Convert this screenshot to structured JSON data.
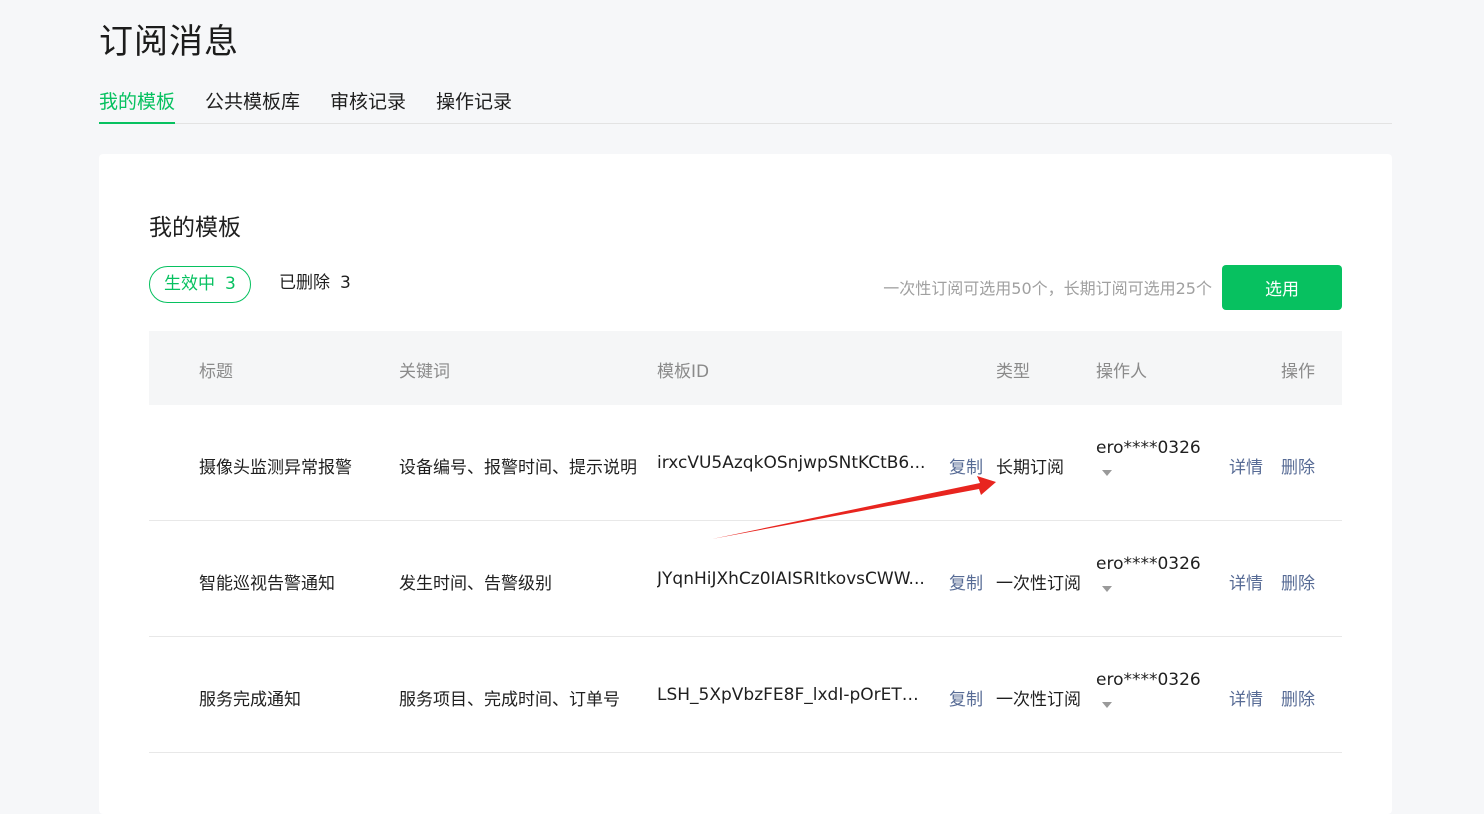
{
  "page": {
    "title": "订阅消息"
  },
  "tabs": [
    {
      "label": "我的模板",
      "active": true
    },
    {
      "label": "公共模板库",
      "active": false
    },
    {
      "label": "审核记录",
      "active": false
    },
    {
      "label": "操作记录",
      "active": false
    }
  ],
  "card": {
    "title": "我的模板",
    "filters": {
      "active": {
        "label": "生效中",
        "count": "3"
      },
      "deleted": {
        "label": "已删除",
        "count": "3"
      }
    },
    "quota_tip": "一次性订阅可选用50个，长期订阅可选用25个",
    "select_button": "选用"
  },
  "table": {
    "headers": {
      "title": "标题",
      "keywords": "关键词",
      "template_id": "模板ID",
      "type": "类型",
      "operator": "操作人",
      "actions": "操作"
    },
    "rows": [
      {
        "title": "摄像头监测异常报警",
        "keywords": "设备编号、报警时间、提示说明",
        "template_id": "irxcVU5AzqkOSnjwpSNtKCtB6...",
        "copy": "复制",
        "type": "长期订阅",
        "operator": "ero****0326",
        "detail": "详情",
        "delete": "删除"
      },
      {
        "title": "智能巡视告警通知",
        "keywords": "发生时间、告警级别",
        "template_id": "JYqnHiJXhCz0IAISRItkovsCWW...",
        "copy": "复制",
        "type": "一次性订阅",
        "operator": "ero****0326",
        "detail": "详情",
        "delete": "删除"
      },
      {
        "title": "服务完成通知",
        "keywords": "服务项目、完成时间、订单号",
        "template_id": "LSH_5XpVbzFE8F_lxdI-pOrET8...",
        "copy": "复制",
        "type": "一次性订阅",
        "operator": "ero****0326",
        "detail": "详情",
        "delete": "删除"
      }
    ]
  },
  "colors": {
    "accent": "#07c160",
    "link": "#576b95",
    "annotation_arrow": "#e8251f"
  }
}
